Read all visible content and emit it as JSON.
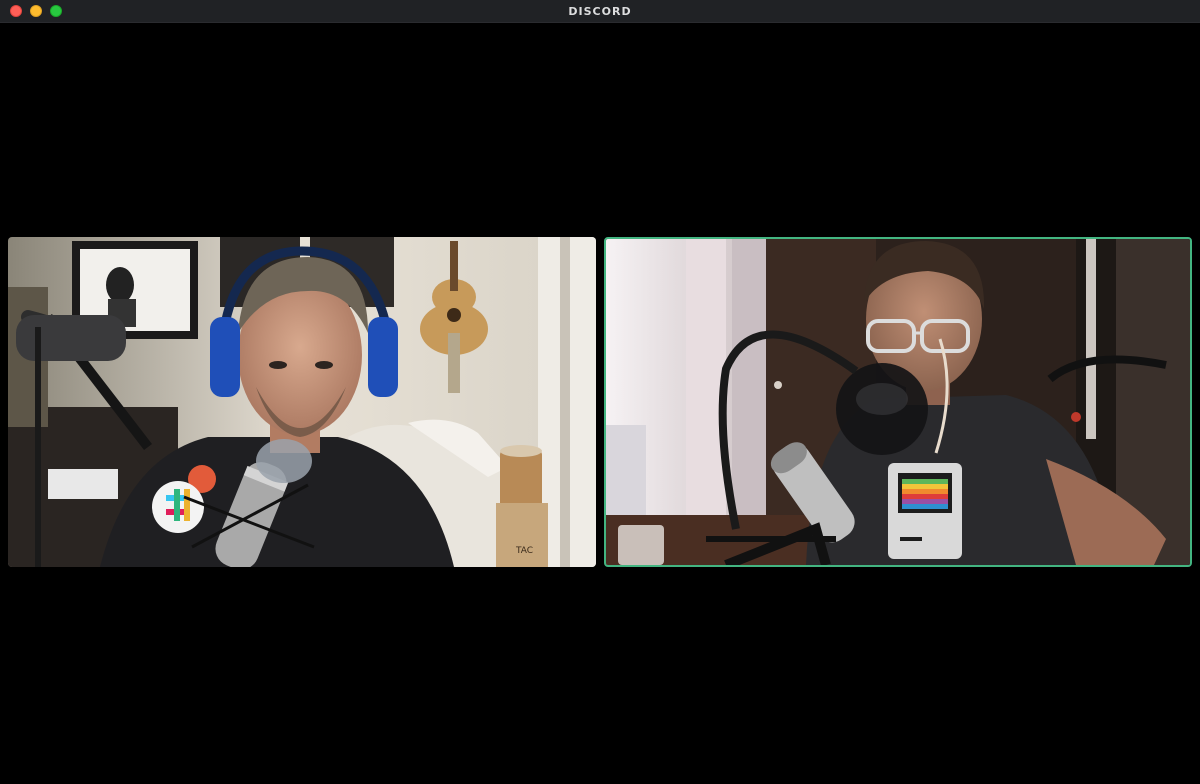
{
  "window": {
    "title": "DISCORD",
    "traffic_lights": [
      "close",
      "minimize",
      "zoom"
    ]
  },
  "call": {
    "participants": [
      {
        "tile": "left",
        "speaking": false
      },
      {
        "tile": "right",
        "speaking": true
      }
    ]
  },
  "colors": {
    "speaking_ring": "#43b581",
    "titlebar": "#202225",
    "background": "#000000"
  }
}
